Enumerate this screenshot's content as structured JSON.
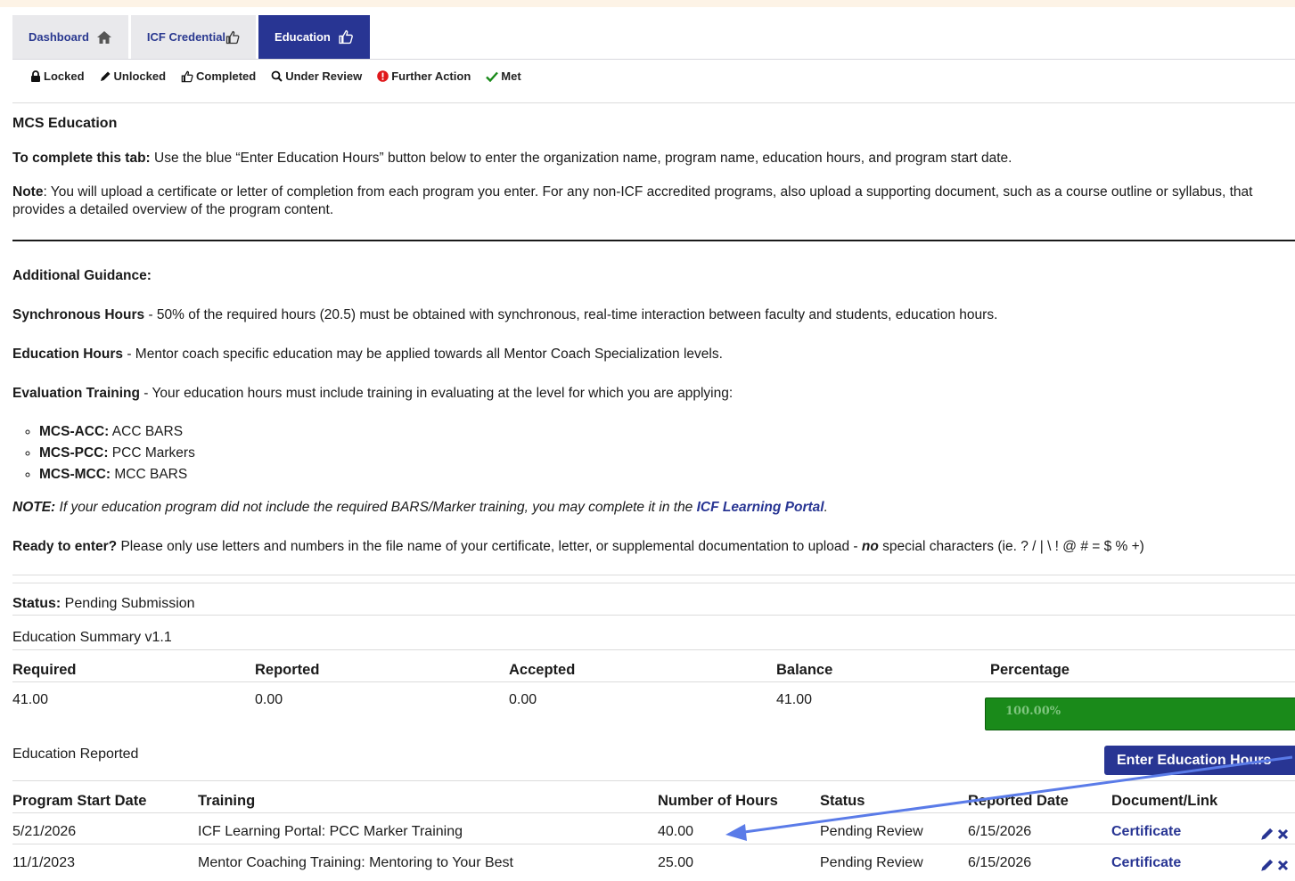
{
  "tabs": [
    {
      "label": "Dashboard",
      "icon": "home-icon"
    },
    {
      "label": "ICF Credential",
      "icon": "thumbs-up-icon"
    },
    {
      "label": "Education",
      "icon": "thumbs-up-icon"
    }
  ],
  "legend": {
    "locked": "Locked",
    "unlocked": "Unlocked",
    "completed": "Completed",
    "under_review": "Under Review",
    "further_action": "Further Action",
    "met": "Met"
  },
  "section_title": "MCS Education",
  "instructions": {
    "complete_lead": "To complete this tab:",
    "complete_text": " Use the blue “Enter Education Hours” button below to enter the organization name, program name, education hours, and program start date.",
    "note_lead": "Note",
    "note_text": ": You will upload a certificate or letter of completion from each program you enter. For any non-ICF accredited programs, also upload a supporting document, such as a course outline or syllabus, that provides a detailed overview of the program content."
  },
  "guidance": {
    "title": "Additional Guidance:",
    "sync_lead": "Synchronous Hours",
    "sync_text": " - 50% of the required hours (20.5) must be obtained with synchronous, real-time interaction between faculty and students, education hours.",
    "edu_lead": "Education Hours",
    "edu_text": " - Mentor coach specific education may be applied towards all Mentor Coach Specialization levels.",
    "eval_lead": "Evaluation Training",
    "eval_text": " - Your education hours must include training in evaluating at the level for which you are applying:",
    "levels": [
      {
        "code": "MCS-ACC:",
        "text": " ACC BARS"
      },
      {
        "code": "MCS-PCC:",
        "text": " PCC Markers"
      },
      {
        "code": "MCS-MCC:",
        "text": " MCC BARS"
      }
    ],
    "note_lead": "NOTE:",
    "note_text": " If your education program did not include the required BARS/Marker training, you may complete it in the ",
    "note_link": "ICF Learning Portal",
    "note_end": ".",
    "ready_lead": "Ready to enter?",
    "ready_text": " Please only use letters and numbers in the file name of your certificate, letter, or supplemental documentation to upload - ",
    "ready_no": "no",
    "ready_end": " special characters (ie. ? / | \\ ! @ # = $ % +)"
  },
  "status": {
    "label": "Status:",
    "value": " Pending Submission"
  },
  "summary": {
    "title": "Education Summary v1.1",
    "headers": [
      "Required",
      "Reported",
      "Accepted",
      "Balance",
      "Percentage"
    ],
    "values": [
      "41.00",
      "0.00",
      "0.00",
      "41.00"
    ],
    "percentage_text": "100.00%",
    "percentage_value": 100,
    "percentage_color": "#1a8a1a"
  },
  "reported": {
    "title": "Education Reported",
    "button_label": "Enter Education Hours",
    "headers": [
      "Program Start Date",
      "Training",
      "Number of Hours",
      "Status",
      "Reported Date",
      "Document/Link"
    ],
    "rows": [
      {
        "start": "5/21/2026",
        "training": "ICF Learning Portal: PCC Marker Training",
        "hours": "40.00",
        "status": "Pending Review",
        "reported": "6/15/2026",
        "doc": "Certificate"
      },
      {
        "start": "11/1/2023",
        "training": "Mentor Coaching Training: Mentoring to Your Best",
        "hours": "25.00",
        "status": "Pending Review",
        "reported": "6/15/2026",
        "doc": "Certificate"
      }
    ]
  },
  "colors": {
    "accent": "#283593",
    "annotation_arrow": "#5a7be8"
  }
}
